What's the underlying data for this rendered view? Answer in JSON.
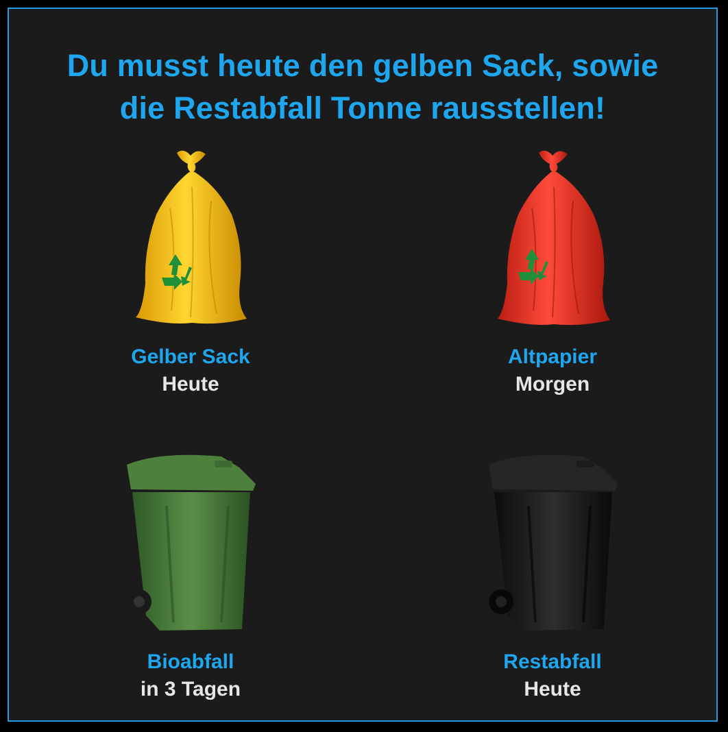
{
  "headline": {
    "line1": "Du musst heute den gelben Sack, sowie",
    "line2": "die Restabfall Tonne rausstellen!"
  },
  "colors": {
    "accent": "#1ea6ef",
    "background": "#1b1b1b",
    "border": "#1e9ee0",
    "when_text": "#e6e6e6"
  },
  "items": [
    {
      "name": "Gelber Sack",
      "when": "Heute",
      "icon": "yellow-bag-icon",
      "color": "#f5c518"
    },
    {
      "name": "Altpapier",
      "when": "Morgen",
      "icon": "red-bag-icon",
      "color": "#e8332a"
    },
    {
      "name": "Bioabfall",
      "when": "in 3 Tagen",
      "icon": "green-bin-icon",
      "color": "#4a7a3a"
    },
    {
      "name": "Restabfall",
      "when": "Heute",
      "icon": "black-bin-icon",
      "color": "#1a1a1a"
    }
  ]
}
